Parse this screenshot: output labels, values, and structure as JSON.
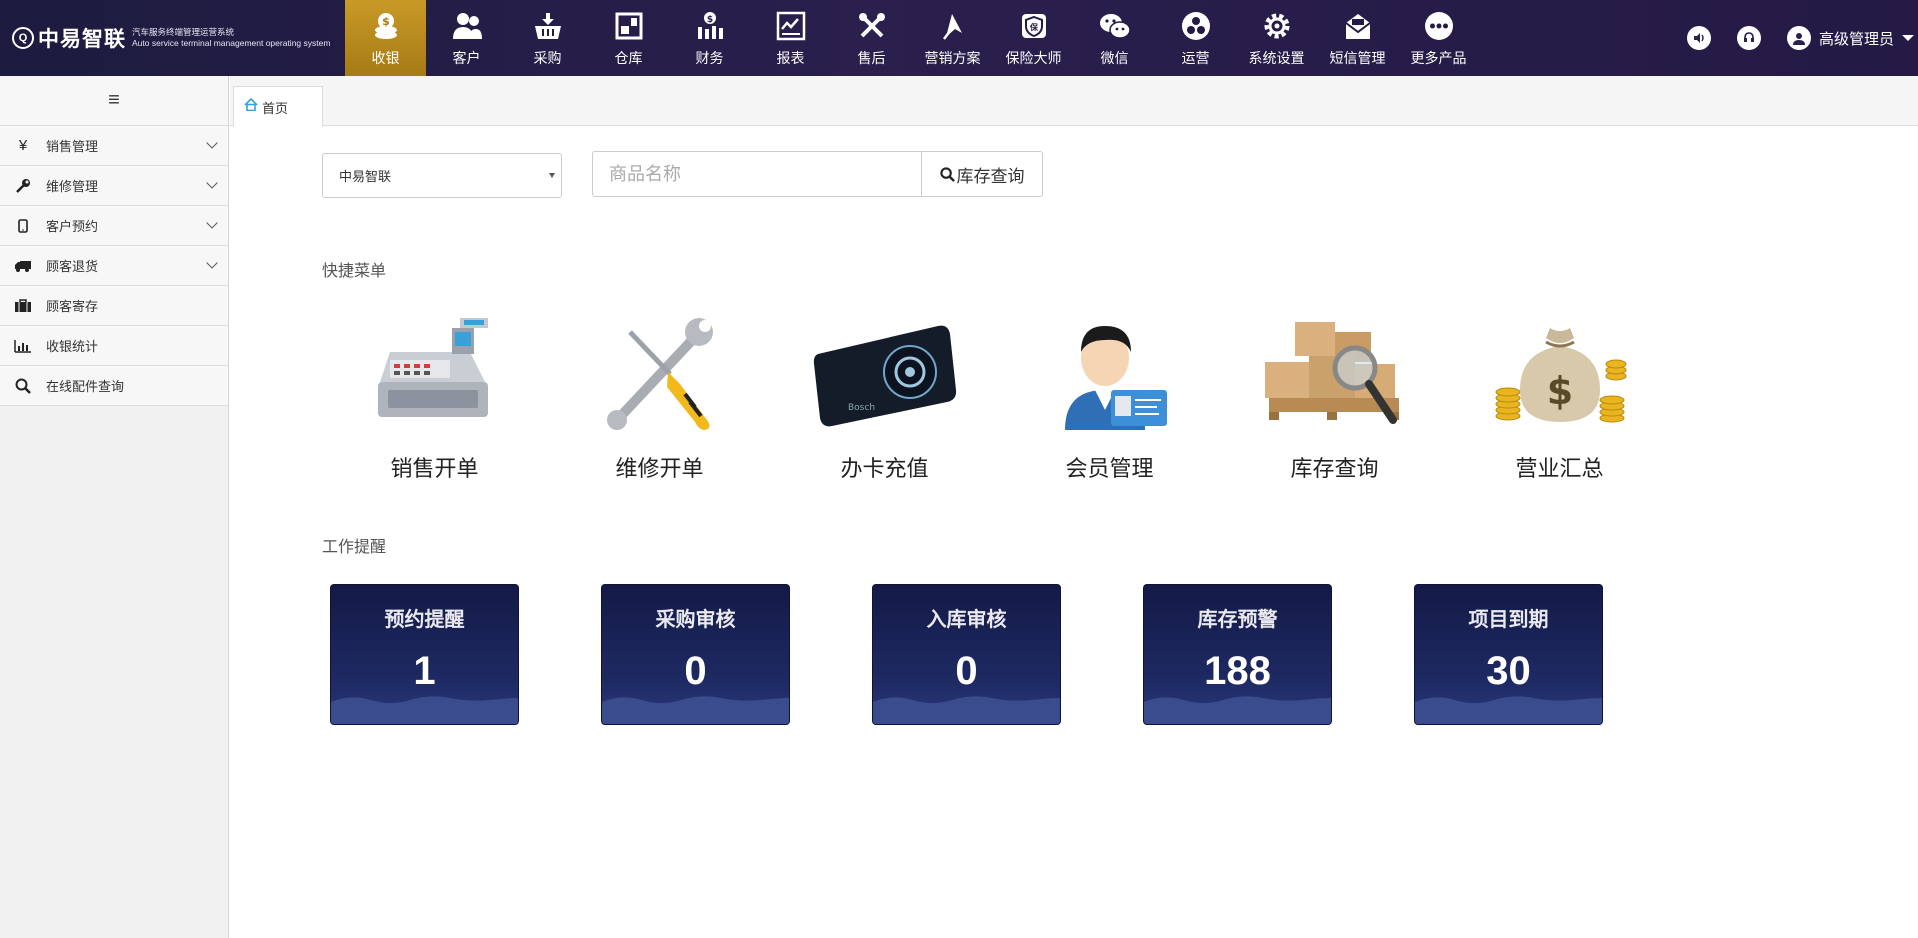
{
  "brand": {
    "name": "中易智联",
    "subtitle_cn": "汽车服务终端管理运营系统",
    "subtitle_en": "Auto service terminal management operating system"
  },
  "nav": [
    {
      "label": "收银",
      "icon": "cashier-icon",
      "active": true
    },
    {
      "label": "客户",
      "icon": "users-icon"
    },
    {
      "label": "采购",
      "icon": "basket-icon"
    },
    {
      "label": "仓库",
      "icon": "warehouse-icon"
    },
    {
      "label": "财务",
      "icon": "finance-icon"
    },
    {
      "label": "报表",
      "icon": "report-icon"
    },
    {
      "label": "售后",
      "icon": "tools-icon"
    },
    {
      "label": "营销方案",
      "icon": "marketing-icon"
    },
    {
      "label": "保险大师",
      "icon": "insurance-icon"
    },
    {
      "label": "微信",
      "icon": "wechat-icon"
    },
    {
      "label": "运营",
      "icon": "operation-icon"
    },
    {
      "label": "系统设置",
      "icon": "gear-icon"
    },
    {
      "label": "短信管理",
      "icon": "sms-icon"
    },
    {
      "label": "更多产品",
      "icon": "more-icon"
    }
  ],
  "user": {
    "name": "高级管理员"
  },
  "sidebar": {
    "items": [
      {
        "label": "销售管理",
        "icon": "yuan-icon",
        "expandable": true
      },
      {
        "label": "维修管理",
        "icon": "wrench-icon",
        "expandable": true
      },
      {
        "label": "客户预约",
        "icon": "mobile-icon",
        "expandable": true
      },
      {
        "label": "顾客退货",
        "icon": "truck-icon",
        "expandable": true
      },
      {
        "label": "顾客寄存",
        "icon": "briefcase-icon",
        "expandable": false
      },
      {
        "label": "收银统计",
        "icon": "bar-chart-icon",
        "expandable": false
      },
      {
        "label": "在线配件查询",
        "icon": "search-icon",
        "expandable": false
      }
    ]
  },
  "tabs": [
    {
      "label": "首页"
    }
  ],
  "toolbar": {
    "store_selected": "中易智联",
    "search_placeholder": "商品名称",
    "search_button": "库存查询"
  },
  "quick_menu": {
    "title": "快捷菜单",
    "items": [
      {
        "label": "销售开单",
        "icon": "cash-register-icon"
      },
      {
        "label": "维修开单",
        "icon": "screwdriver-wrench-icon"
      },
      {
        "label": "办卡充值",
        "icon": "card-icon"
      },
      {
        "label": "会员管理",
        "icon": "member-icon"
      },
      {
        "label": "库存查询",
        "icon": "inventory-icon"
      },
      {
        "label": "营业汇总",
        "icon": "money-bag-icon"
      }
    ]
  },
  "work_reminder": {
    "title": "工作提醒",
    "cards": [
      {
        "title": "预约提醒",
        "value": "1"
      },
      {
        "title": "采购审核",
        "value": "0"
      },
      {
        "title": "入库审核",
        "value": "0"
      },
      {
        "title": "库存预警",
        "value": "188"
      },
      {
        "title": "项目到期",
        "value": "30"
      }
    ]
  },
  "colors": {
    "topbar": "#241a45",
    "nav_active": "#b88a20",
    "card_bg": "#1a2258"
  }
}
